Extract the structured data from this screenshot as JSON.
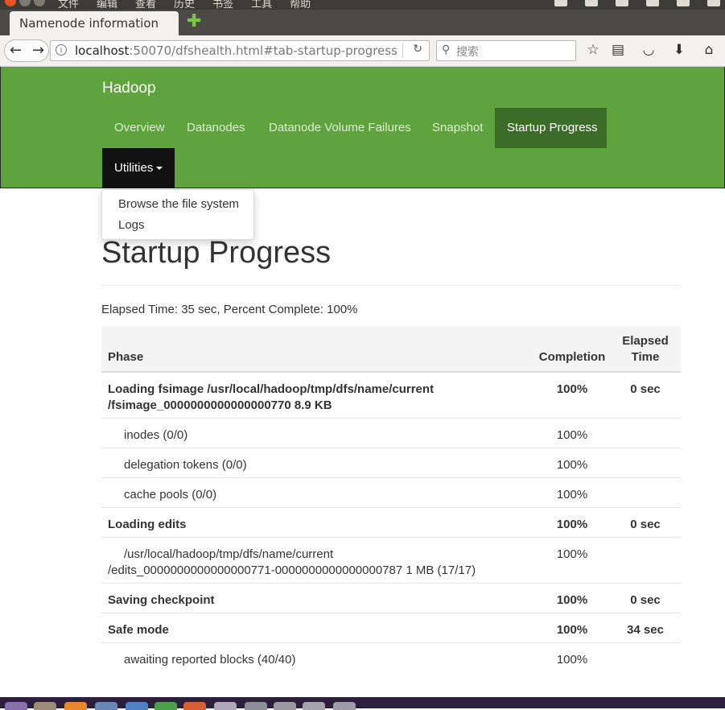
{
  "os": {
    "menu": [
      "文件",
      "编辑",
      "查看",
      "历史",
      "书签",
      "工具",
      "帮助"
    ]
  },
  "browser": {
    "tab_title": "Namenode information",
    "url_host": "localhost",
    "url_rest": ":50070/dfshealth.html#tab-startup-progress",
    "search_placeholder": "搜索"
  },
  "navbar": {
    "brand": "Hadoop",
    "items": [
      "Overview",
      "Datanodes",
      "Datanode Volume Failures",
      "Snapshot",
      "Startup Progress"
    ],
    "active": "Startup Progress",
    "utilities_label": "Utilities",
    "dropdown": [
      "Browse the file system",
      "Logs"
    ]
  },
  "page": {
    "title": "Startup Progress",
    "elapsed": "Elapsed Time: 35 sec, Percent Complete: 100%"
  },
  "table": {
    "headers": {
      "phase": "Phase",
      "completion": "Completion",
      "elapsed_line1": "Elapsed",
      "elapsed_line2": "Time"
    },
    "rows": [
      {
        "phase_line1": "Loading fsimage /usr/local/hadoop/tmp/dfs/name/current",
        "phase_line2": "/fsimage_0000000000000000770 8.9 KB",
        "completion": "100%",
        "elapsed": "0 sec"
      },
      {
        "phase_line1": "inodes (0/0)",
        "completion": "100%",
        "elapsed": ""
      },
      {
        "phase_line1": "delegation tokens (0/0)",
        "completion": "100%",
        "elapsed": ""
      },
      {
        "phase_line1": "cache pools (0/0)",
        "completion": "100%",
        "elapsed": ""
      },
      {
        "phase_line1": "Loading edits",
        "completion": "100%",
        "elapsed": "0 sec"
      },
      {
        "phase_line1": "/usr/local/hadoop/tmp/dfs/name/current",
        "phase_line2": "/edits_0000000000000000771-0000000000000000787 1 MB (17/17)",
        "completion": "100%",
        "elapsed": ""
      },
      {
        "phase_line1": "Saving checkpoint",
        "completion": "100%",
        "elapsed": "0 sec"
      },
      {
        "phase_line1": "Safe mode",
        "completion": "100%",
        "elapsed": "34 sec"
      },
      {
        "phase_line1": "awaiting reported blocks (40/40)",
        "completion": "100%",
        "elapsed": ""
      }
    ]
  },
  "colors": {
    "navbar": "#5fa33e",
    "active_tab": "#3b6d28",
    "utilities": "#111111"
  },
  "icons": [
    "back-arrow-icon",
    "forward-arrow-icon",
    "info-icon",
    "reload-icon",
    "search-icon",
    "star-icon",
    "reading-list-icon",
    "pocket-icon",
    "download-icon",
    "home-icon",
    "new-tab-plus-icon",
    "caret-down-icon"
  ]
}
